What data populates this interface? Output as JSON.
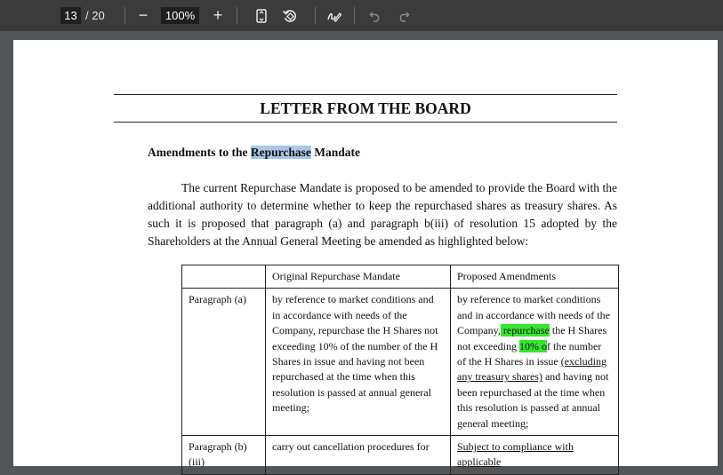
{
  "toolbar": {
    "current_page": "13",
    "page_total": "/ 20",
    "zoom": "100%",
    "zoom_out_symbol": "−",
    "zoom_in_symbol": "+",
    "icons": [
      "zoom-out-icon",
      "zoom-in-icon",
      "fit-page-icon",
      "rotate-icon",
      "annotate-pen-icon",
      "undo-icon",
      "redo-icon"
    ]
  },
  "document": {
    "title": "LETTER FROM THE BOARD",
    "heading_before": "Amendments to the ",
    "heading_selected": "Repurchase",
    "heading_after": " Mandate",
    "paragraph": "The current Repurchase Mandate is proposed to be amended to provide the Board with the additional authority to determine whether to keep the repurchased shares as treasury shares. As such it is proposed that paragraph (a) and paragraph b(iii) of resolution 15 adopted by the Shareholders at the Annual General Meeting be amended as highlighted below:",
    "table": {
      "headers": [
        "",
        "Original Repurchase Mandate",
        "Proposed Amendments"
      ],
      "rows": [
        {
          "label": "Paragraph (a)",
          "original": "by reference to market conditions and in accordance with needs of the Company, repurchase the H Shares not exceeding 10% of the number of the H Shares in issue and having not been repurchased at the time when this resolution is passed at annual general meeting;",
          "proposed_1": "by reference to market conditions and in accordance with needs of the Company,",
          "proposed_hl1": " repurchase",
          "proposed_2": " the H Shares not exceeding ",
          "proposed_hl2": "10% o",
          "proposed_3": "f the number of the H Shares in issue ",
          "proposed_ul": "(excluding any treasury shares)",
          "proposed_4": " and having not been repurchased at the time when this resolution is passed at annual general meeting;"
        },
        {
          "label": "Paragraph (b)(iii)",
          "original": "carry out cancellation procedures for",
          "proposed_ul": "Subject to compliance with applicable"
        }
      ]
    }
  },
  "colors": {
    "toolbar_bg": "#3b3b3b",
    "viewer_bg": "#525659",
    "selection": "#a9c7e8",
    "highlight": "#35e62b"
  }
}
